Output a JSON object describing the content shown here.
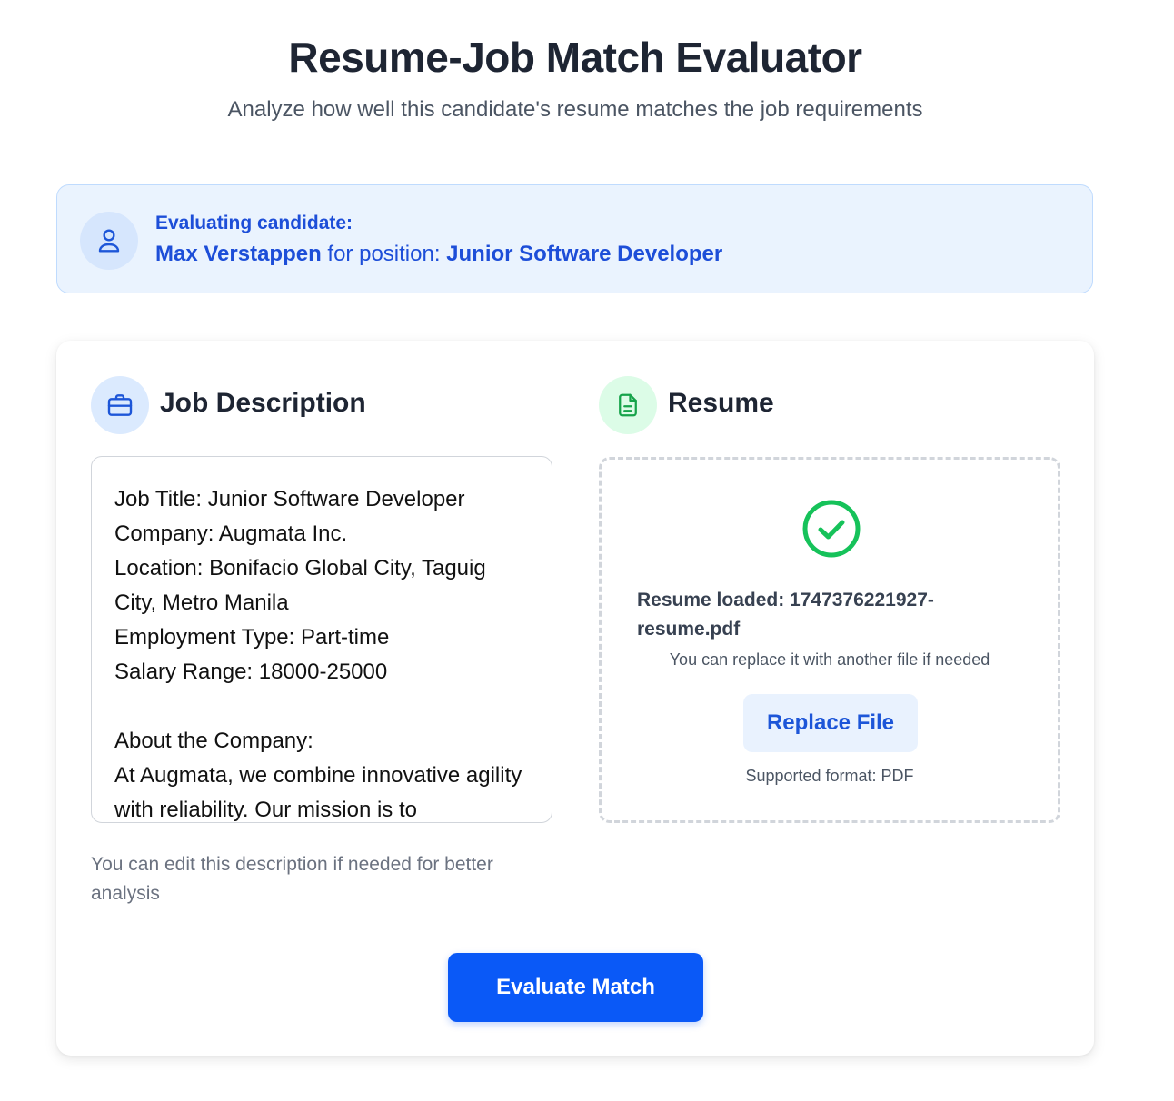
{
  "header": {
    "title": "Resume-Job Match Evaluator",
    "subtitle": "Analyze how well this candidate's resume matches the job requirements"
  },
  "candidate": {
    "label": "Evaluating candidate:",
    "name": "Max Verstappen",
    "position_prefix": " for position: ",
    "position": "Junior Software Developer",
    "icon": "user-icon"
  },
  "job_description": {
    "title": "Job Description",
    "icon": "briefcase-icon",
    "text": "Job Title: Junior Software Developer\nCompany: Augmata Inc.\nLocation: Bonifacio Global City, Taguig City, Metro Manila\nEmployment Type: Part-time\nSalary Range: 18000-25000\n\nAbout the Company:\nAt Augmata, we combine innovative agility with reliability. Our mission is to",
    "hint": "You can edit this description if needed for better analysis"
  },
  "resume": {
    "title": "Resume",
    "icon": "document-icon",
    "status_icon": "check-circle-icon",
    "loaded_text": "Resume loaded: 1747376221927-resume.pdf",
    "replace_hint": "You can replace it with another file if needed",
    "replace_button": "Replace File",
    "format_text": "Supported format: PDF"
  },
  "actions": {
    "evaluate_button": "Evaluate Match"
  },
  "colors": {
    "primary": "#0a59f7",
    "banner_bg": "#eaf3fe",
    "banner_text": "#1d4ed8",
    "success": "#16c25a",
    "resume_icon_bg": "#dcfce7"
  }
}
